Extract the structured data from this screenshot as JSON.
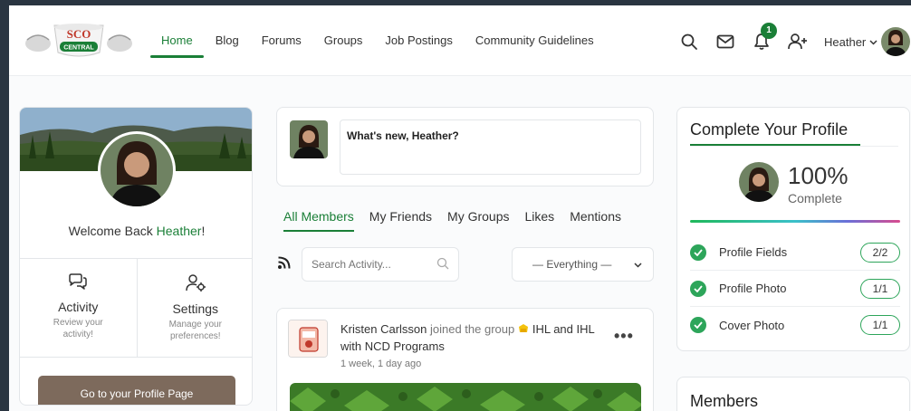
{
  "brand": {
    "logo_top": "SCO",
    "logo_bottom": "CENTRAL"
  },
  "nav": {
    "items": [
      {
        "label": "Home",
        "active": true
      },
      {
        "label": "Blog",
        "active": false
      },
      {
        "label": "Forums",
        "active": false
      },
      {
        "label": "Groups",
        "active": false
      },
      {
        "label": "Job Postings",
        "active": false
      },
      {
        "label": "Community Guidelines",
        "active": false
      }
    ]
  },
  "header": {
    "icons": [
      "search-icon",
      "mail-icon",
      "bell-icon",
      "add-friend-icon"
    ],
    "notification_count": "1",
    "user_name": "Heather"
  },
  "left_card": {
    "welcome_prefix": "Welcome Back ",
    "welcome_name": "Heather",
    "welcome_suffix": "!",
    "activity_title": "Activity",
    "activity_sub": "Review your activity!",
    "settings_title": "Settings",
    "settings_sub": "Manage your preferences!",
    "profile_button": "Go to your Profile Page"
  },
  "composer": {
    "placeholder": "What's new, Heather?"
  },
  "activity_tabs": [
    {
      "label": "All Members",
      "active": true
    },
    {
      "label": "My Friends",
      "active": false
    },
    {
      "label": "My Groups",
      "active": false
    },
    {
      "label": "Likes",
      "active": false
    },
    {
      "label": "Mentions",
      "active": false
    }
  ],
  "filters": {
    "search_placeholder": "Search Activity...",
    "select_value": "— Everything —"
  },
  "activity": {
    "actor": "Kristen Carlsson",
    "action": " joined the group ",
    "group": "IHL and IHL with NCD Programs",
    "time": "1 week, 1 day ago",
    "more": "•••"
  },
  "profile_card": {
    "title": "Complete Your Profile",
    "percent": "100%",
    "complete_label": "Complete",
    "rows": [
      {
        "label": "Profile Fields",
        "value": "2/2"
      },
      {
        "label": "Profile Photo",
        "value": "1/1"
      },
      {
        "label": "Cover Photo",
        "value": "1/1"
      }
    ]
  },
  "members_card": {
    "title": "Members"
  },
  "colors": {
    "accent": "#1a7f37",
    "button": "#7d6a5c",
    "check": "#2da55a"
  }
}
